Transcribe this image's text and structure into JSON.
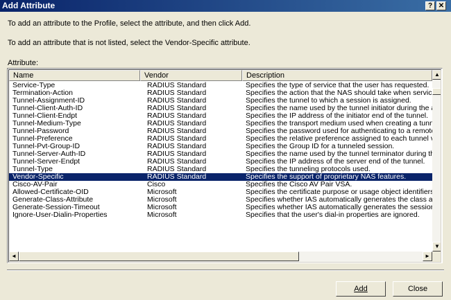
{
  "window": {
    "title": "Add Attribute",
    "help_label": "?",
    "close_label": "✕"
  },
  "instructions": {
    "line1": "To add an attribute to the Profile, select the attribute, and then click Add.",
    "line2": "To add an attribute that is not listed, select the Vendor-Specific attribute."
  },
  "attribute_label": "Attribute:",
  "table": {
    "columns": [
      "Name",
      "Vendor",
      "Description"
    ],
    "rows": [
      {
        "name": "Service-Type",
        "vendor": "RADIUS Standard",
        "description": "Specifies the type of service that the user has requested.",
        "selected": false
      },
      {
        "name": "Termination-Action",
        "vendor": "RADIUS Standard",
        "description": "Specifies the action that the NAS should take when servic",
        "selected": false
      },
      {
        "name": "Tunnel-Assignment-ID",
        "vendor": "RADIUS Standard",
        "description": "Specifies the tunnel to which a session is assigned.",
        "selected": false
      },
      {
        "name": "Tunnel-Client-Auth-ID",
        "vendor": "RADIUS Standard",
        "description": "Specifies the name used by the tunnel initiator during the a",
        "selected": false
      },
      {
        "name": "Tunnel-Client-Endpt",
        "vendor": "RADIUS Standard",
        "description": "Specifies the IP address of the initiator end of the tunnel.",
        "selected": false
      },
      {
        "name": "Tunnel-Medium-Type",
        "vendor": "RADIUS Standard",
        "description": "Specifies the transport medium used when creating a tunn",
        "selected": false
      },
      {
        "name": "Tunnel-Password",
        "vendor": "RADIUS Standard",
        "description": "Specifies the password used for authenticating to a remote",
        "selected": false
      },
      {
        "name": "Tunnel-Preference",
        "vendor": "RADIUS Standard",
        "description": "Specifies the relative preference assigned to each tunnel v",
        "selected": false
      },
      {
        "name": "Tunnel-Pvt-Group-ID",
        "vendor": "RADIUS Standard",
        "description": "Specifies the Group ID for a tunneled session.",
        "selected": false
      },
      {
        "name": "Tunnel-Server-Auth-ID",
        "vendor": "RADIUS Standard",
        "description": "Specifies the name used by the tunnel terminator during th",
        "selected": false
      },
      {
        "name": "Tunnel-Server-Endpt",
        "vendor": "RADIUS Standard",
        "description": "Specifies the IP address of the server end of the tunnel.",
        "selected": false
      },
      {
        "name": "Tunnel-Type",
        "vendor": "RADIUS Standard",
        "description": "Specifies the tunneling protocols used.",
        "selected": false
      },
      {
        "name": "Vendor-Specific",
        "vendor": "RADIUS Standard",
        "description": "Specifies the support of proprietary NAS features.",
        "selected": true
      },
      {
        "name": "Cisco-AV-Pair",
        "vendor": "Cisco",
        "description": "Specifies the Cisco AV Pair VSA.",
        "selected": false
      },
      {
        "name": "Allowed-Certificate-OID",
        "vendor": "Microsoft",
        "description": "Specifies the certificate purpose or usage object identifiers",
        "selected": false
      },
      {
        "name": "Generate-Class-Attribute",
        "vendor": "Microsoft",
        "description": "Specifies whether IAS automatically generates the class at",
        "selected": false
      },
      {
        "name": "Generate-Session-Timeout",
        "vendor": "Microsoft",
        "description": "Specifies whether IAS automatically generates the session",
        "selected": false
      },
      {
        "name": "Ignore-User-Dialin-Properties",
        "vendor": "Microsoft",
        "description": "Specifies that the user's dial-in properties are ignored.",
        "selected": false
      }
    ]
  },
  "scroll_icons": {
    "up": "▲",
    "down": "▼",
    "left": "◄",
    "right": "►"
  },
  "buttons": {
    "add_label": "Add",
    "close_label": "Close"
  },
  "colors": {
    "selection": "#0a246a",
    "title_bar": "#0a246a",
    "dialog_bg": "#ece9d8"
  }
}
